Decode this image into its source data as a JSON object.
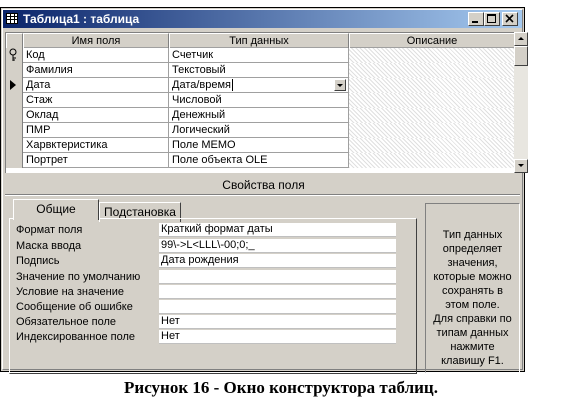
{
  "window": {
    "title": "Таблица1 : таблица"
  },
  "grid": {
    "headers": [
      "Имя поля",
      "Тип данных",
      "Описание"
    ],
    "rows": [
      {
        "name": "Код",
        "type": "Счетчик",
        "desc": "",
        "marker": "key"
      },
      {
        "name": "Фамилия",
        "type": "Текстовый",
        "desc": "",
        "marker": ""
      },
      {
        "name": "Дата",
        "type": "Дата/время",
        "desc": "",
        "marker": "current"
      },
      {
        "name": "Стаж",
        "type": "Числовой",
        "desc": "",
        "marker": ""
      },
      {
        "name": "Оклад",
        "type": "Денежный",
        "desc": "",
        "marker": ""
      },
      {
        "name": "ПМР",
        "type": "Логический",
        "desc": "",
        "marker": ""
      },
      {
        "name": "Харвктеристика",
        "type": "Поле MEMO",
        "desc": "",
        "marker": ""
      },
      {
        "name": "Портрет",
        "type": "Поле объекта OLE",
        "desc": "",
        "marker": ""
      }
    ]
  },
  "properties": {
    "section_title": "Свойства поля",
    "tabs": [
      "Общие",
      "Подстановка"
    ],
    "rows": [
      {
        "label": "Формат поля",
        "value": "Краткий формат даты"
      },
      {
        "label": "Маска ввода",
        "value": "99\\->L<LLL\\-00;0;_"
      },
      {
        "label": "Подпись",
        "value": "Дата рождения"
      },
      {
        "label": "Значение по умолчанию",
        "value": ""
      },
      {
        "label": "Условие на значение",
        "value": ""
      },
      {
        "label": "Сообщение об ошибке",
        "value": ""
      },
      {
        "label": "Обязательное поле",
        "value": "Нет"
      },
      {
        "label": "Индексированное поле",
        "value": "Нет"
      }
    ],
    "hint_lines": [
      "Тип данных",
      "определяет",
      "значения,",
      "которые можно",
      "сохранять в",
      "этом поле.",
      "Для справки по",
      "типам данных",
      "нажмите",
      "клавишу F1."
    ]
  },
  "caption": "Рисунок 16 - Окно конструктора таблиц."
}
